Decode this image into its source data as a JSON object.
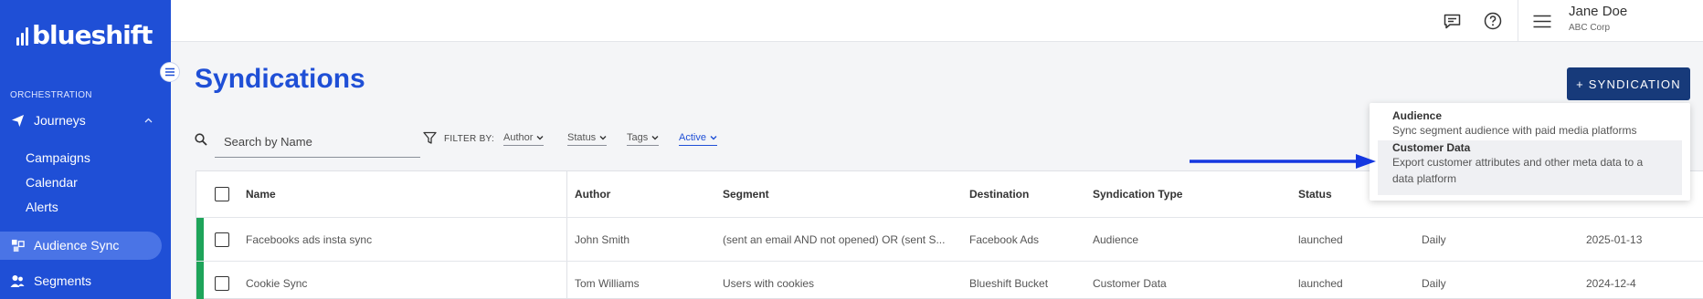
{
  "app": {
    "brand": "blueshift"
  },
  "colors": {
    "brand_blue": "#1f4fd6",
    "dark_button": "#173a7a",
    "status_green": "#1ea45a"
  },
  "header": {
    "user_name": "Jane Doe",
    "user_org": "ABC Corp",
    "icons": [
      "chat-icon",
      "help-icon",
      "hamburger-menu-icon"
    ]
  },
  "sidebar": {
    "section_label": "ORCHESTRATION",
    "journeys_label": "Journeys",
    "sub_items": [
      "Campaigns",
      "Calendar",
      "Alerts"
    ],
    "audience_sync_label": "Audience Sync",
    "segments_label": "Segments"
  },
  "page": {
    "title": "Syndications",
    "add_button": "+ SYNDICATION",
    "search_placeholder": "Search by Name",
    "filter_label": "FILTER BY:",
    "filters": [
      "Author",
      "Status",
      "Tags",
      "Active"
    ],
    "active_filter": "Active"
  },
  "menu": {
    "items": [
      {
        "title": "Audience",
        "description": "Sync segment audience with paid media platforms"
      },
      {
        "title": "Customer Data",
        "description_line1": "Export customer attributes and other meta data to a",
        "description_line2": "data platform"
      }
    ],
    "highlighted": "Customer Data"
  },
  "table": {
    "columns": [
      "Name",
      "Author",
      "Segment",
      "Destination",
      "Syndication Type",
      "Status"
    ],
    "rows": [
      {
        "name": "Facebooks ads insta sync",
        "author": "John Smith",
        "segment": "(sent an email AND not opened) OR (sent S...",
        "destination": "Facebook Ads",
        "type": "Audience",
        "status": "launched",
        "frequency": "Daily",
        "date": "2025-01-13"
      },
      {
        "name": "Cookie Sync",
        "author": "Tom Williams",
        "segment": "Users with cookies",
        "destination": "Blueshift Bucket",
        "type": "Customer Data",
        "status": "launched",
        "frequency": "Daily",
        "date": "2024-12-4"
      }
    ]
  }
}
